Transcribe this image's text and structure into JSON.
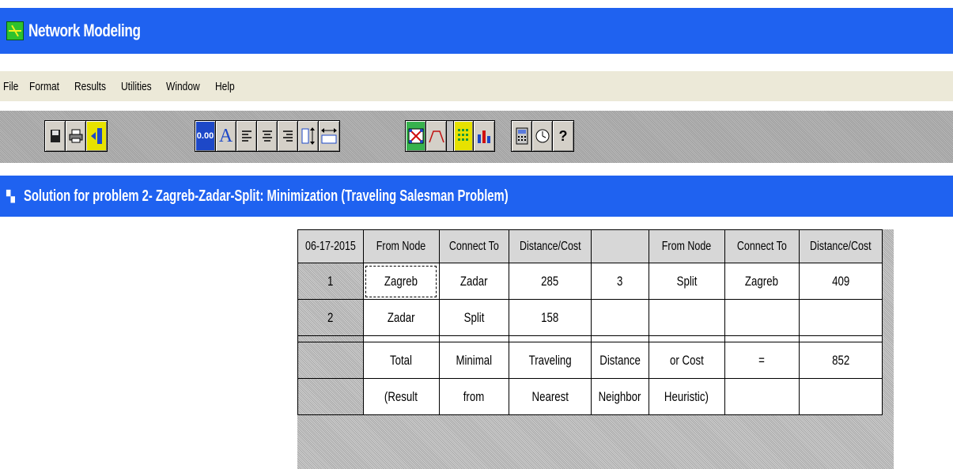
{
  "window": {
    "title": "Network Modeling",
    "icon": "network-modeling-app-icon"
  },
  "menu": [
    "File",
    "Format",
    "Results",
    "Utilities",
    "Window",
    "Help"
  ],
  "toolbar": {
    "groups": [
      [
        "save-icon",
        "print-icon",
        "exit-icon"
      ],
      [
        "decimal-format-icon",
        "font-icon",
        "align-left-icon",
        "align-center-icon",
        "align-right-icon",
        "row-height-icon",
        "column-width-icon"
      ],
      [
        "graph-network-icon",
        "curve-chart-icon",
        "grid-view-icon",
        "bar-chart-icon"
      ],
      [
        "calculator-icon",
        "clock-icon",
        "help-icon"
      ]
    ],
    "labels": {
      "decimal": "0.00",
      "font": "A",
      "help": "?"
    }
  },
  "solution_window": {
    "title": "Solution for problem 2- Zagreb-Zadar-Split: Minimization (Traveling Salesman Problem)",
    "icon": "document-window-icon"
  },
  "table": {
    "header": [
      "06-17-2015",
      "From Node",
      "Connect To",
      "Distance/Cost",
      "",
      "From Node",
      "Connect To",
      "Distance/Cost"
    ],
    "rows": [
      [
        "1",
        "Zagreb",
        "Zadar",
        "285",
        "3",
        "Split",
        "Zagreb",
        "409"
      ],
      [
        "2",
        "Zadar",
        "Split",
        "158",
        "",
        "",
        "",
        ""
      ],
      [
        "",
        "Total",
        "Minimal",
        "Traveling",
        "Distance",
        "or Cost",
        "=",
        "852"
      ],
      [
        "",
        "(Result",
        "from",
        "Nearest",
        "Neighbor",
        "Heuristic)",
        "",
        ""
      ]
    ]
  },
  "colors": {
    "title_blue": "#1f62f0",
    "menu_bg": "#ece9d8",
    "toolbar_gray": "#a8a8a8"
  }
}
